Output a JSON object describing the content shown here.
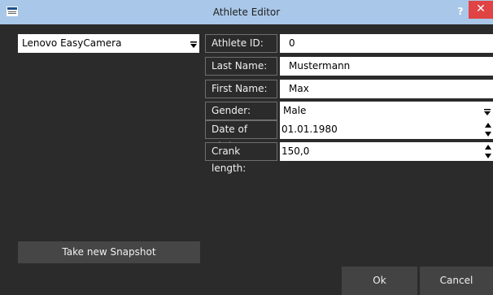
{
  "window": {
    "title": "Athlete Editor",
    "help_label": "?",
    "close_label": "✕"
  },
  "camera": {
    "selected": "Lenovo EasyCamera"
  },
  "form": {
    "athlete_id": {
      "label": "Athlete ID:",
      "value": "0"
    },
    "last_name": {
      "label": "Last Name:",
      "value": "Mustermann"
    },
    "first_name": {
      "label": "First Name:",
      "value": "Max"
    },
    "gender": {
      "label": "Gender:",
      "value": "Male"
    },
    "date_of_birth": {
      "label": "Date of Birth:",
      "value": "01.01.1980"
    },
    "crank_length": {
      "label": "Crank length:",
      "value": "150,0"
    }
  },
  "buttons": {
    "snapshot": "Take new Snapshot",
    "ok": "Ok",
    "cancel": "Cancel"
  },
  "colors": {
    "titlebar": "#a9c7e8",
    "close": "#e04343",
    "background": "#2b2b2b",
    "button": "#464646"
  }
}
